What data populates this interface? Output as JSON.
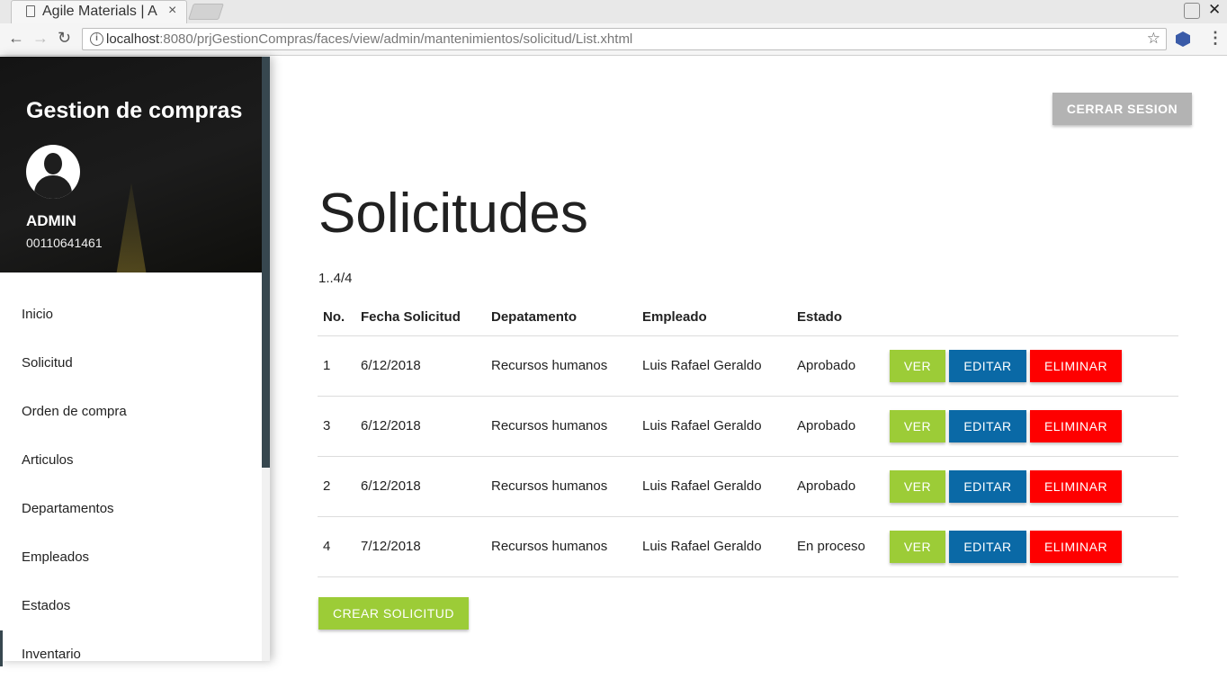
{
  "browser": {
    "tab_title": "Agile Materials | A",
    "tab_close": "×",
    "url_host": "localhost",
    "url_rest": ":8080/prjGestionCompras/faces/view/admin/mantenimientos/solicitud/List.xhtml",
    "window_close": "✕"
  },
  "sidebar": {
    "app_title": "Gestion de compras",
    "user_name": "ADMIN",
    "user_id": "00110641461",
    "items": [
      {
        "label": "Inicio"
      },
      {
        "label": "Solicitud"
      },
      {
        "label": "Orden de compra"
      },
      {
        "label": "Articulos"
      },
      {
        "label": "Departamentos"
      },
      {
        "label": "Empleados"
      },
      {
        "label": "Estados"
      },
      {
        "label": "Inventario"
      }
    ]
  },
  "header": {
    "logout_label": "CERRAR SESION"
  },
  "main": {
    "title": "Solicitudes",
    "pager": "1..4/4",
    "columns": [
      "No.",
      "Fecha Solicitud",
      "Depatamento",
      "Empleado",
      "Estado"
    ],
    "rows": [
      {
        "no": "1",
        "fecha": "6/12/2018",
        "departamento": "Recursos humanos",
        "empleado": "Luis Rafael Geraldo",
        "estado": "Aprobado"
      },
      {
        "no": "3",
        "fecha": "6/12/2018",
        "departamento": "Recursos humanos",
        "empleado": "Luis Rafael Geraldo",
        "estado": "Aprobado"
      },
      {
        "no": "2",
        "fecha": "6/12/2018",
        "departamento": "Recursos humanos",
        "empleado": "Luis Rafael Geraldo",
        "estado": "Aprobado"
      },
      {
        "no": "4",
        "fecha": "7/12/2018",
        "departamento": "Recursos humanos",
        "empleado": "Luis Rafael Geraldo",
        "estado": "En proceso"
      }
    ],
    "actions": {
      "view": "VER",
      "edit": "EDITAR",
      "delete": "ELIMINAR"
    },
    "create_label": "CREAR SOLICITUD"
  },
  "colors": {
    "view": "#9ccc37",
    "edit": "#0a69a6",
    "delete": "#fe0000",
    "logout": "#b3b3b3",
    "sidebar_accent": "#37474f"
  },
  "icons": [
    "page-icon",
    "back-icon",
    "forward-icon",
    "reload-icon",
    "info-icon",
    "star-icon",
    "extension-icon",
    "menu-icon",
    "user-avatar-icon"
  ]
}
